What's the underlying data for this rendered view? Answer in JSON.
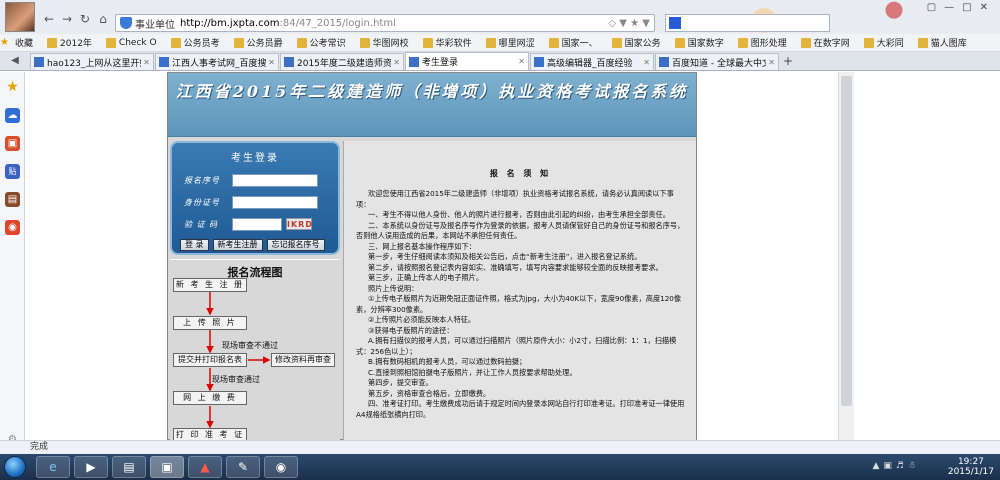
{
  "browser": {
    "address": {
      "site_label": "事业单位",
      "host": "http://bm.jxpta.com",
      "path": ":84/47_2015/login.html"
    },
    "favorites": [
      "收藏",
      "2012年",
      "Check O",
      "公务员考",
      "公务员爵",
      "公考常识",
      "华图网校",
      "华彩软件",
      "哪里网涩",
      "国家一、",
      "国家公务",
      "国家数字",
      "图形处理",
      "在数字网",
      "大彩同",
      "猫人图库"
    ],
    "tabs": [
      {
        "label": "hao123_上网从这里开始",
        "active": false
      },
      {
        "label": "江西人事考试网_百度搜索",
        "active": false
      },
      {
        "label": "2015年度二级建造师资格",
        "active": false
      },
      {
        "label": "考生登录",
        "active": true
      },
      {
        "label": "高级编辑器_百度经验",
        "active": false
      },
      {
        "label": "百度知道 - 全球最大中文",
        "active": false
      }
    ],
    "status": "完成"
  },
  "taskbar": {
    "time": "19:27",
    "date": "2015/1/17"
  },
  "page": {
    "banner_title": "江西省2015年二级建造师（非增项）执业资格考试报名系统",
    "login": {
      "title": "考生登录",
      "field_seq": "报名序号",
      "field_id": "身份证号",
      "field_code": "验 证 码",
      "captcha": "IKRD",
      "btn_login": "登 录",
      "btn_register": "新考生注册",
      "btn_forgot": "忘记报名序号"
    },
    "flow": {
      "title": "报名流程图",
      "step1": "新 考 生 注 册",
      "step2": "上  传  照  片",
      "step3": "提交并打印报名表",
      "step3b": "修改资料再审查",
      "step4": "网  上  缴  费",
      "step5": "打 印 准 考 证",
      "note_fail": "现场审查不通过",
      "note_pass": "现场审查通过"
    },
    "notice": {
      "title": "报 名 须 知",
      "paragraphs": [
        "欢迎您使用江西省2015年二级建造师（非增项）执业资格考试报名系统，请务必认真阅读以下事项：",
        "一、考生不得以他人身份、他人的照片进行报考，否则由此引起的纠纷，由考生承担全部责任。",
        "二、本系统以身份证号及报名序号作为登录的依据，报考人员请保管好自己的身份证号和报名序号，否则他人误用造成的后果，本网站不承担任何责任。",
        "三、网上报名基本操作程序如下：",
        "第一步，考生仔细阅读本须知及相关公告后，点击“新考生注册”，进入报名登记系统。",
        "第二步，请按照报名登记表内容如实、准确填写，填写内容要求能够较全面的反映报考要求。",
        "第三步，正确上传本人的电子照片。",
        "照片上传说明：",
        "①上传电子版照片为近期免冠正面证件照，格式为jpg，大小为40K以下，宽度90像素，高度120像素，分辨率300像素。",
        "②上传照片必须能反映本人特征。",
        "③获得电子版照片的途径：",
        "A.拥有扫描仪的报考人员，可以通过扫描照片（照片原件大小：小2寸，扫描比例：1：1，扫描模式：256色以上）；",
        "B.拥有数码相机的报考人员，可以通过数码拍摄；",
        "C.直接到照相馆拍摄电子版照片，并让工作人员按要求帮助处理。",
        "第四步，提交审查。",
        "第五步，资格审查合格后，立即缴费。",
        "四、准考证打印。考生缴费成功后请于规定时间内登录本网站自行打印准考证。打印准考证一律使用A4规格纸张横向打印。"
      ]
    }
  }
}
